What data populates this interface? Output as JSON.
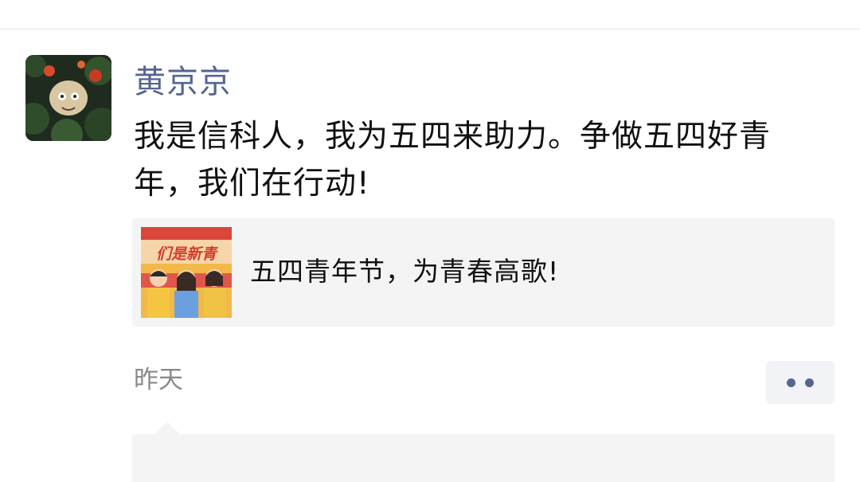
{
  "post": {
    "username": "黄京京",
    "content": "我是信科人，我为五四来助力。争做五四好青年，我们在行动!",
    "link_card": {
      "title": "五四青年节，为青春高歌!",
      "thumbnail_banner_text": "们是新青"
    },
    "time": "昨天"
  },
  "icons": {
    "avatar": "cartoon-avatar-image",
    "more": "more-dots-icon"
  },
  "colors": {
    "username": "#56658f",
    "content_text": "#111111",
    "card_background": "#f4f4f4",
    "time_text": "#8a8a8a",
    "more_button_background": "#f2f3f7"
  }
}
